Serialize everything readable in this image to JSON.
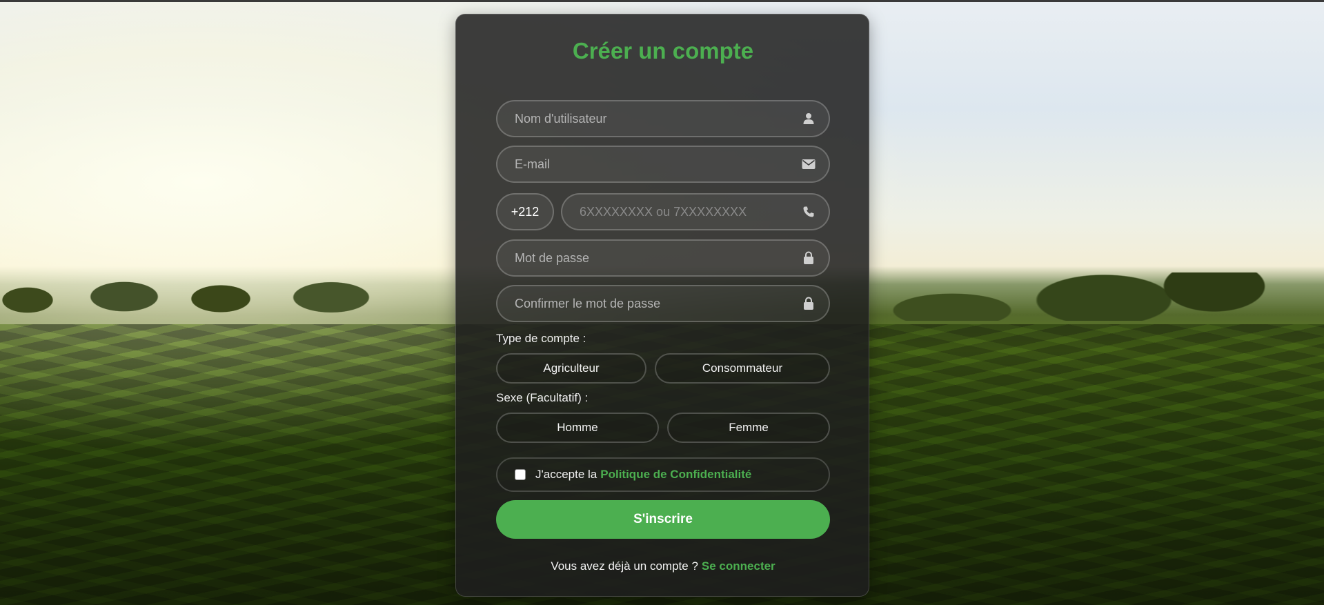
{
  "colors": {
    "accent": "#4caf50",
    "card_bg": "#1e1e1e",
    "text": "#f3f3f3",
    "placeholder": "#b5b5b5"
  },
  "form": {
    "title": "Créer un compte",
    "username_placeholder": "Nom d'utilisateur",
    "email_placeholder": "E-mail",
    "phone_prefix": "+212",
    "phone_placeholder": "6XXXXXXXX ou 7XXXXXXXX",
    "password_placeholder": "Mot de passe",
    "confirm_password_placeholder": "Confirmer le mot de passe",
    "account_type_label": "Type de compte :",
    "account_types": [
      "Agriculteur",
      "Consommateur"
    ],
    "gender_label": "Sexe (Facultatif) :",
    "genders": [
      "Homme",
      "Femme"
    ],
    "terms_text": "J'accepte la",
    "terms_link": "Politique de Confidentialité",
    "terms_checked": false,
    "submit_label": "S'inscrire",
    "login_prompt": "Vous avez déjà un compte ?",
    "login_link": "Se connecter"
  },
  "icons": {
    "username": "user-icon",
    "email": "envelope-icon",
    "phone": "phone-icon",
    "password": "lock-icon",
    "confirm_password": "lock-icon"
  }
}
